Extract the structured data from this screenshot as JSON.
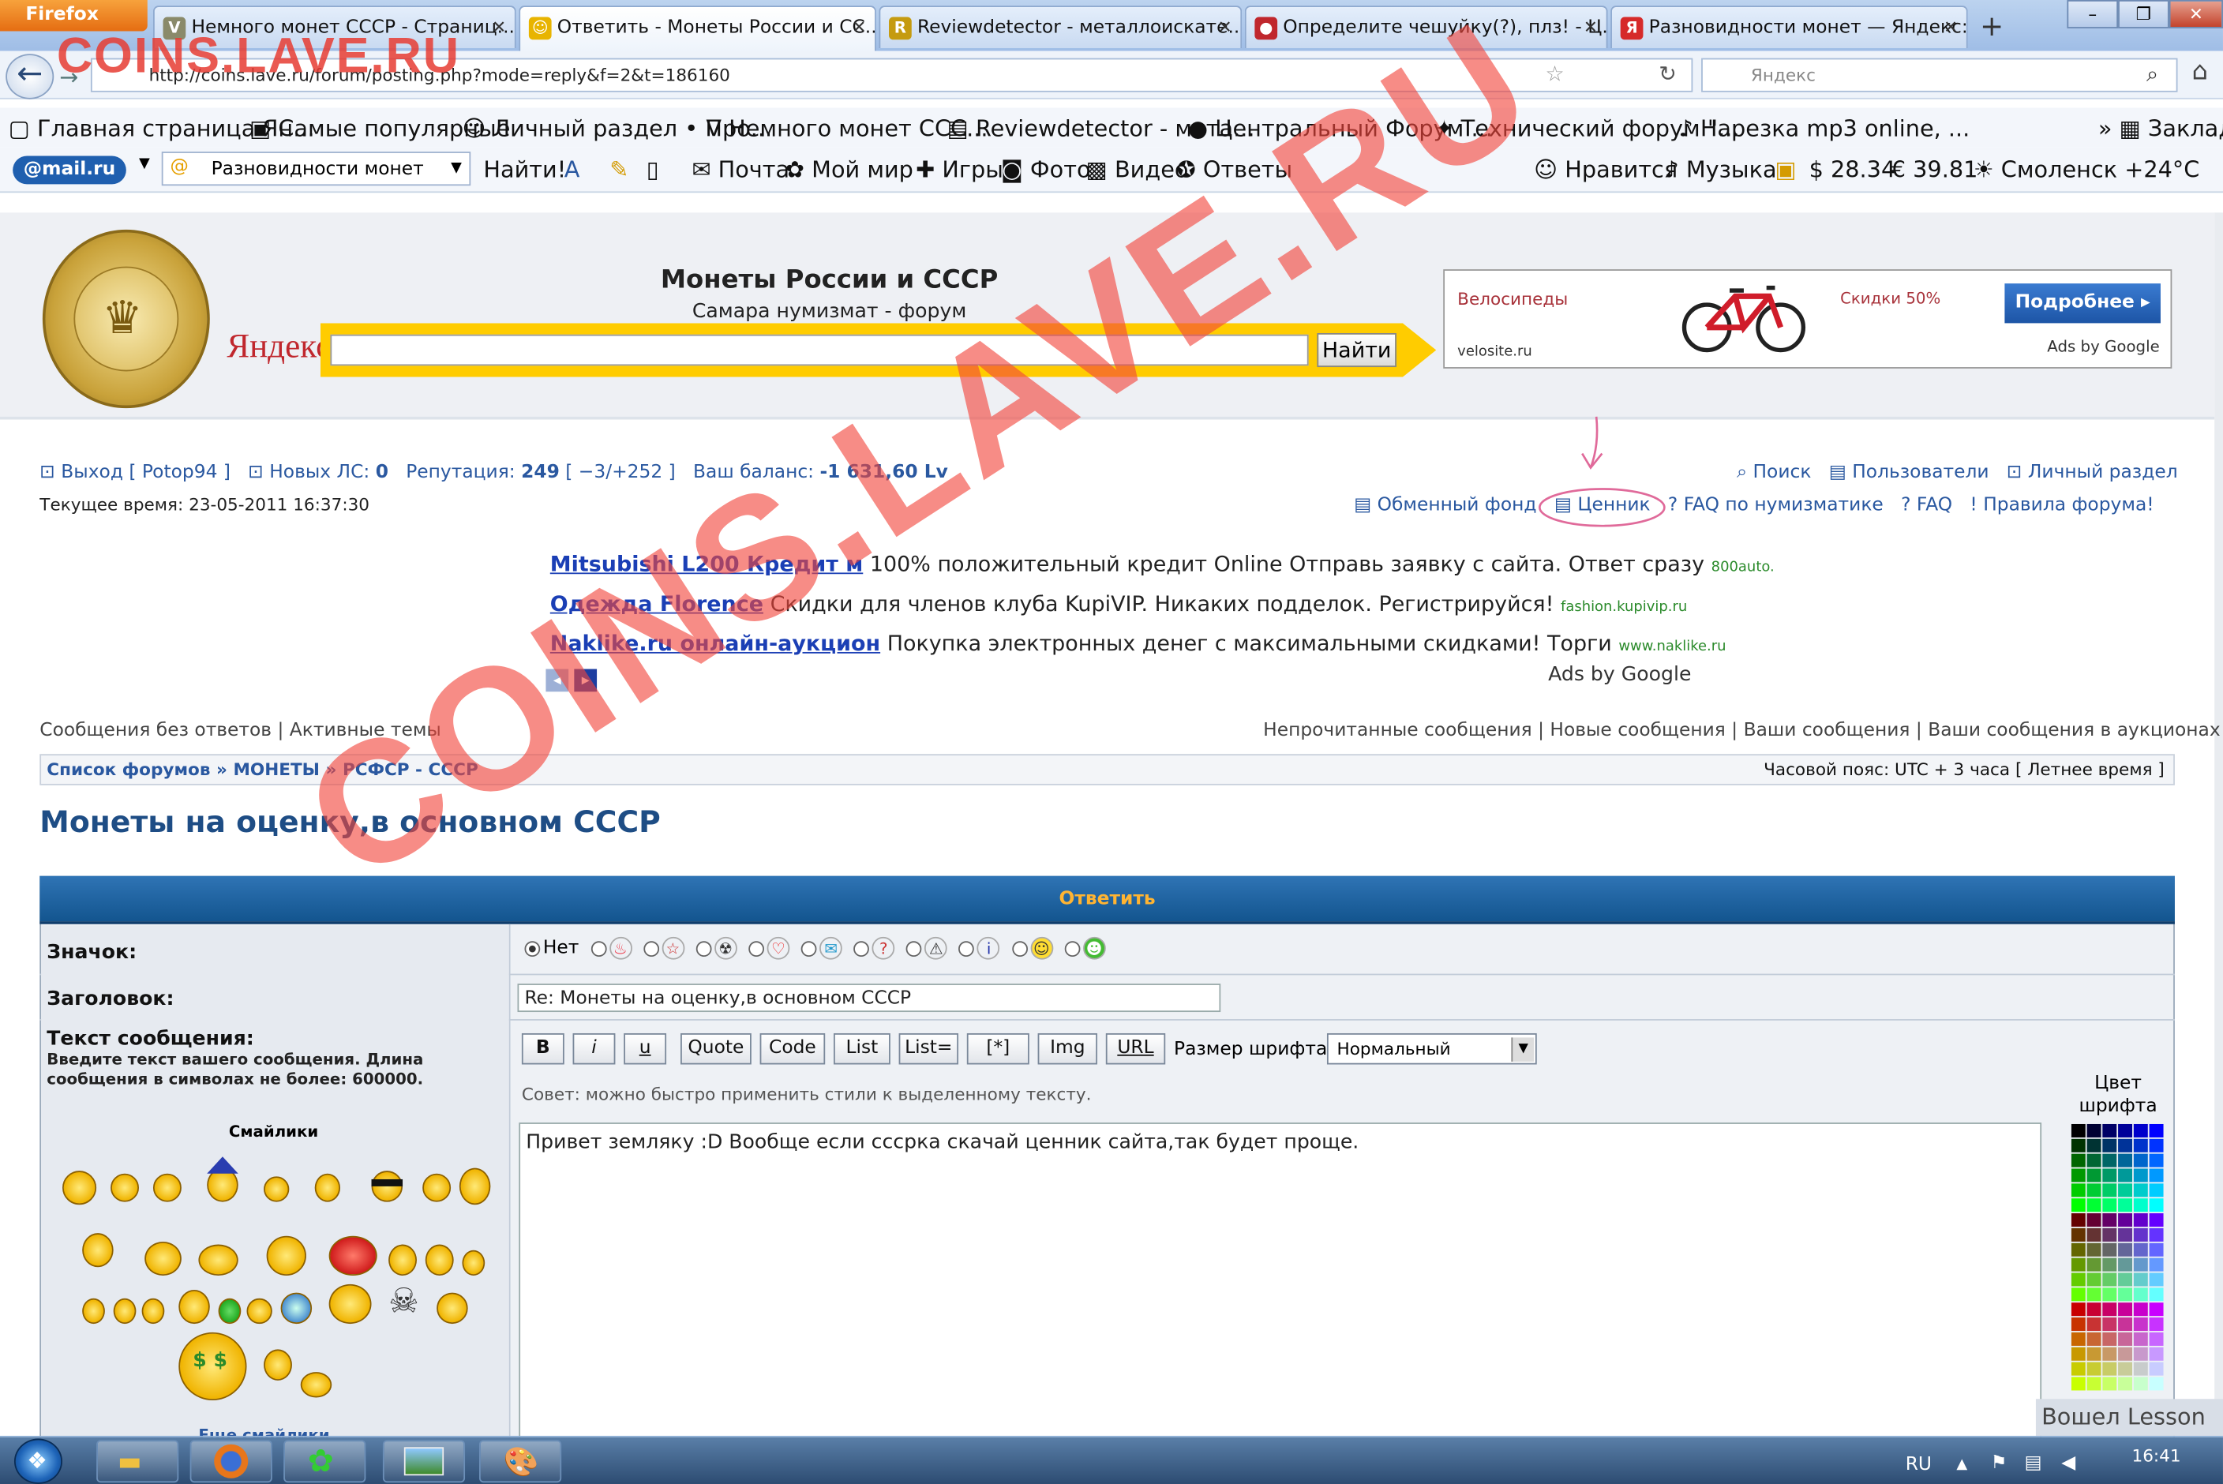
{
  "browser": {
    "firefox_label": "Firefox",
    "tabs": [
      {
        "label": "Немного монет СССР - Страниц..."
      },
      {
        "label": "Ответить - Монеты России и СС..."
      },
      {
        "label": "Reviewdetector - металлоискате..."
      },
      {
        "label": "Определите чешуйку(?), плз! - Ц..."
      },
      {
        "label": "Разновидности монет — Яндекс:..."
      }
    ],
    "url": "http://coins.lave.ru/forum/posting.php?mode=reply&f=2&t=186160",
    "search_placeholder": "Яндекс",
    "bookmarks": [
      "Главная страница Ян...",
      "Самые популярные",
      "Личный раздел • Про...",
      "Немного монет ССС...",
      "Reviewdetector - мета...",
      "Центральный Форум ...",
      "Технический форум \"...",
      "Нарезка mp3 online, ...",
      "Заклад"
    ],
    "mail_logo": "@mail.ru",
    "mail_search": "Разновидности монет",
    "mail_find": "Найти!",
    "mail_links": [
      "Почта",
      "Мой мир",
      "Игры",
      "Фото",
      "Видео",
      "Ответы",
      "Нравится",
      "Музыка",
      "28.34",
      "39.81",
      "Смоленск +24°C"
    ]
  },
  "site": {
    "title": "Монеты России и СССР",
    "subtitle": "Самара нумизмат - форум",
    "yandex": "Яндекс",
    "search_button": "Найти",
    "ad": {
      "text": "Велосипеды",
      "domain": "velosite.ru",
      "sale": "Скидки 50%",
      "button": "Подробнее ▸",
      "by": "Ads by Google"
    }
  },
  "user": {
    "logout": "Выход [ Potop94 ]",
    "new_pm_label": "Новых ЛС:",
    "new_pm": "0",
    "rep_label": "Репутация:",
    "rep": "249",
    "rep_detail": "[ −3/+252 ]",
    "balance_label": "Ваш баланс:",
    "balance": "-1 631,60 Lv",
    "time": "Текущее время: 23-05-2011 16:37:30"
  },
  "nav": {
    "right1": [
      "Поиск",
      "Пользователи",
      "Личный раздел"
    ],
    "right2": [
      "Обменный фонд",
      "Ценник",
      "FAQ по нумизматике",
      "FAQ",
      "Правила форума!"
    ]
  },
  "ads": [
    {
      "link": "Mitsubishi L200 Кредит м",
      "text": "100% положительный кредит Online Отправь заявку с сайта. Ответ сразу",
      "domain": "800auto."
    },
    {
      "link": "Одежда Florence",
      "text": "Скидки для членов клуба KupiVIP. Никаких подделок. Регистрируйся!",
      "domain": "fashion.kupivip.ru"
    },
    {
      "link": "Naklike.ru онлайн-аукцион",
      "text": "Покупка электронных денег с максимальными скидками! Торги",
      "domain": "www.naklike.ru"
    }
  ],
  "ads_by": "Ads by Google",
  "links_left": "Сообщения без ответов | Активные темы",
  "links_right": "Непрочитанные сообщения | Новые сообщения | Ваши сообщения | Ваши сообщения в аукционах",
  "breadcrumbs": [
    "Список форумов",
    "МОНЕТЫ",
    "РСФСР - СССР"
  ],
  "timezone": "Часовой пояс: UTC + 3 часа [ Летнее время ]",
  "topic_title": "Монеты на оценку,в основном СССР",
  "form": {
    "header": "Ответить",
    "icon_label": "Значок:",
    "icon_none": "Нет",
    "subject_label": "Заголовок:",
    "subject_value": "Re: Монеты на оценку,в основном СССР",
    "message_label": "Текст сообщения:",
    "message_desc": "Введите текст вашего сообщения. Длина сообщения в символах не более: 600000.",
    "smilies_label": "Смайлики",
    "more_smilies": "Еще смайлики",
    "buttons": [
      "B",
      "i",
      "u",
      "Quote",
      "Code",
      "List",
      "List=",
      "[*]",
      "Img",
      "URL"
    ],
    "font_size_label": "Размер шрифта:",
    "font_size_value": "Нормальный",
    "hint": "Совет: можно быстро применить стили к выделенному тексту.",
    "message_text": "Привет земляку :D   Вообще если сссрка скачай ценник сайта,так будет проще.",
    "color_label": "Цвет шрифта"
  },
  "overlay": {
    "small": "COINS.LAVE.RU",
    "big": "COINS.LAVE.RU",
    "corner": "Вошел Lesson"
  },
  "taskbar": {
    "lang": "RU",
    "clock": "16:41"
  },
  "colors": {
    "header_blue": "#13558f",
    "link": "#2a58a0",
    "title": "#1e4d85",
    "accent_orange": "#ffb432"
  }
}
